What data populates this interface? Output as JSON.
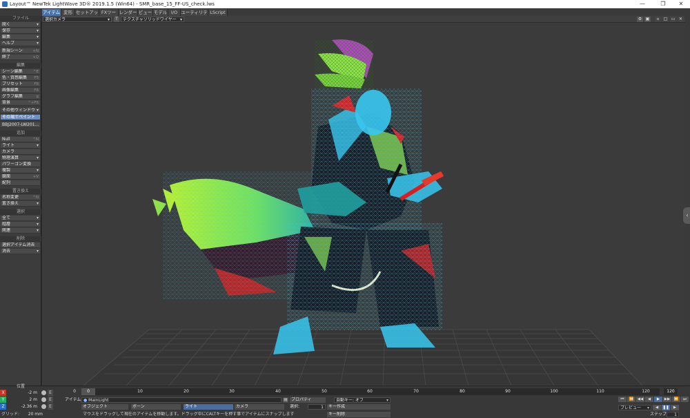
{
  "window": {
    "title": "Layout™ NewTek LightWave 3D® 2019.1.5 (Win64) - SMR_base_15_FF-US_check.lws",
    "controls": [
      "—",
      "❐",
      "✕"
    ]
  },
  "tabs": [
    "アイテム",
    "変形",
    "セットアップ",
    "FXツール",
    "レンダー",
    "ビュー",
    "モデル",
    "I/O",
    "ユーティリティ",
    "LScript"
  ],
  "sidebar": {
    "sections": {
      "file": "ファイル",
      "edit": "編集",
      "add": "追加",
      "replace": "置き換え",
      "select": "選択",
      "delete": "削除"
    },
    "items": [
      {
        "label": "開く",
        "shortcut": "",
        "dropdown": true
      },
      {
        "label": "保存",
        "shortcut": "",
        "dropdown": true
      },
      {
        "label": "編集",
        "shortcut": "",
        "dropdown": true
      },
      {
        "label": "ヘルプ",
        "shortcut": "",
        "dropdown": true
      },
      {
        "label": "新規シーン",
        "shortcut": "+N"
      },
      {
        "label": "終了",
        "shortcut": "+Q"
      },
      {
        "label": "シーン編集",
        "shortcut": "^E"
      },
      {
        "label": "色・質感編集",
        "shortcut": "F5"
      },
      {
        "label": "プリセット",
        "shortcut": "F8"
      },
      {
        "label": "画像編集",
        "shortcut": "F6"
      },
      {
        "label": "グラフ編集",
        "shortcut": "g"
      },
      {
        "label": "背景",
        "shortcut": "^+F6"
      },
      {
        "label": "その他ウィンドウ",
        "shortcut": "",
        "dropdown": true
      },
      {
        "label": "その場でペイント",
        "shortcut": "",
        "highlight": true
      },
      {
        "label": "BBJ2007-LW201...",
        "shortcut": ""
      },
      {
        "label": "Null",
        "shortcut": "^N"
      },
      {
        "label": "ライト",
        "shortcut": "",
        "dropdown": true
      },
      {
        "label": "カメラ",
        "shortcut": ""
      },
      {
        "label": "物理演算",
        "shortcut": "",
        "dropdown": true
      },
      {
        "label": "パワーゴン変換",
        "shortcut": ""
      },
      {
        "label": "複製",
        "shortcut": "",
        "dropdown": true
      },
      {
        "label": "鏡面",
        "shortcut": "+V"
      },
      {
        "label": "配列",
        "shortcut": ""
      },
      {
        "label": "名称変更",
        "shortcut": "^N"
      },
      {
        "label": "置き換え",
        "shortcut": "",
        "dropdown": true
      },
      {
        "label": "全て",
        "shortcut": "",
        "dropdown": true
      },
      {
        "label": "階層",
        "shortcut": "",
        "dropdown": true
      },
      {
        "label": "関連",
        "shortcut": "",
        "dropdown": true
      },
      {
        "label": "選択アイテム消去",
        "shortcut": ""
      },
      {
        "label": "消去",
        "shortcut": "",
        "dropdown": true
      }
    ]
  },
  "viewport": {
    "camera_select": "選択カメラ",
    "shading_select": "テクスチャソリッドワイヤー",
    "right_icons": [
      "gear-icon",
      "display-icon",
      "min-icon",
      "max-icon",
      "restore-icon",
      "close-icon"
    ],
    "edge_tab": "‹"
  },
  "bottom": {
    "position_label": "位置",
    "axes": [
      {
        "axis": "X",
        "value": "-2 m",
        "color": "#c0392b"
      },
      {
        "axis": "Y",
        "value": "2 m",
        "color": "#27ae60"
      },
      {
        "axis": "Z",
        "value": "-2.36 m",
        "color": "#2c6fbf"
      }
    ],
    "grid_label": "グリッド:",
    "grid_value": "20 mm",
    "frame_current": "0",
    "timeline_ticks": [
      "0",
      "10",
      "20",
      "30",
      "40",
      "50",
      "60",
      "70",
      "80",
      "90",
      "100",
      "110",
      "120"
    ],
    "timeline_end": "120",
    "item_label": "アイテム",
    "item_value": "MainLight",
    "object_btn": "オブジェクト",
    "bone_btn": "ボーン",
    "light_btn": "ライト",
    "camera_btn": "カメラ",
    "property_btn": "プロパティ",
    "autokey": "自動キー: オフ",
    "select_label": "選択:",
    "select_value": "1",
    "create_key": "キー作成",
    "delete_key": "キー削除",
    "preview": "プレビュー",
    "step_label": "ステップ",
    "step_value": "1",
    "status_text": "マウスをドラッグして現在のアイテムを移動します。ドラッグ中にCALTキーを押す事でアイテムにスナップします",
    "play_buttons": [
      "⏮",
      "⏪",
      "◀◀",
      "◀",
      "▶",
      "▶▶",
      "⏩",
      "⏭"
    ]
  },
  "colors": {
    "accent": "#4c73a8",
    "wire_cyan": "#38c8f0",
    "wire_green": "#8fe04a",
    "wire_red": "#d82020",
    "wire_magenta": "#c050d0"
  }
}
